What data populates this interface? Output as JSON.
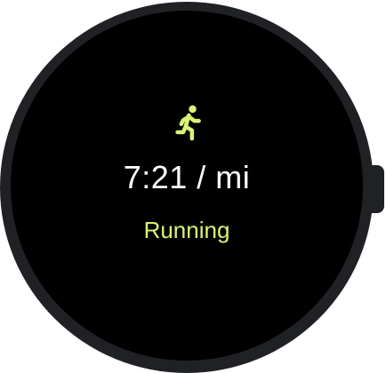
{
  "workout": {
    "icon": "running-icon",
    "pace": "7:21 / mi",
    "activity": "Running",
    "accent_color": "#d9f475"
  }
}
